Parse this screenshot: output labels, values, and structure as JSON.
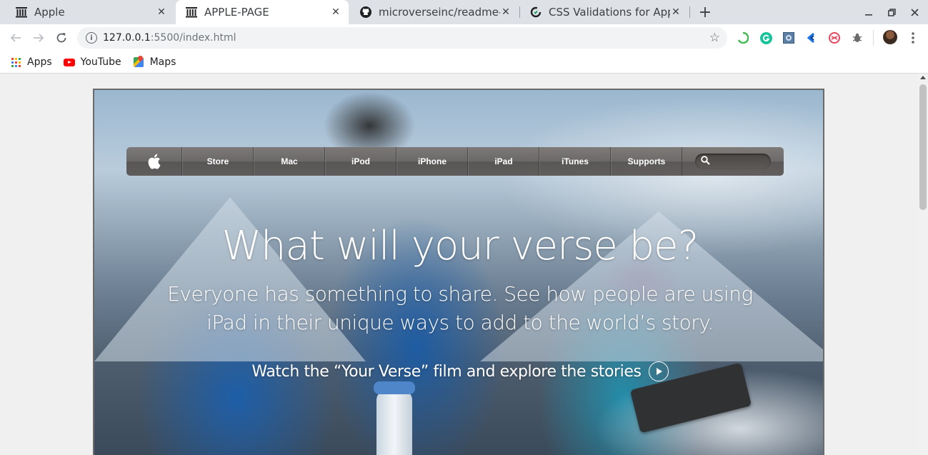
{
  "browser": {
    "tabs": [
      {
        "title": "Apple",
        "active": false
      },
      {
        "title": "APPLE-PAGE",
        "active": true
      },
      {
        "title": "microverseinc/readme-ter",
        "active": false
      },
      {
        "title": "CSS Validations for Apple",
        "active": false
      }
    ],
    "new_tab_label": "+",
    "url_host": "127.0.0.1",
    "url_path": ":5500/index.html",
    "bookmarks": [
      {
        "label": "Apps",
        "icon": "apps-grid-icon"
      },
      {
        "label": "YouTube",
        "icon": "youtube-icon"
      },
      {
        "label": "Maps",
        "icon": "maps-icon"
      }
    ]
  },
  "page": {
    "nav": {
      "items": [
        "Store",
        "Mac",
        "iPod",
        "iPhone",
        "iPad",
        "iTunes",
        "Supports"
      ],
      "search_placeholder": ""
    },
    "hero": {
      "title": "What will your verse be?",
      "subtitle_line1": "Everyone has something to share. See how people are using",
      "subtitle_line2": "iPad in their unique ways to add to the world’s story.",
      "cta": "Watch the “Your Verse” film and explore the stories"
    }
  },
  "colors": {
    "accent_brand": "#ffffff",
    "nav_bar": "#6a6664",
    "chrome_tabstrip": "#dee1e6"
  }
}
